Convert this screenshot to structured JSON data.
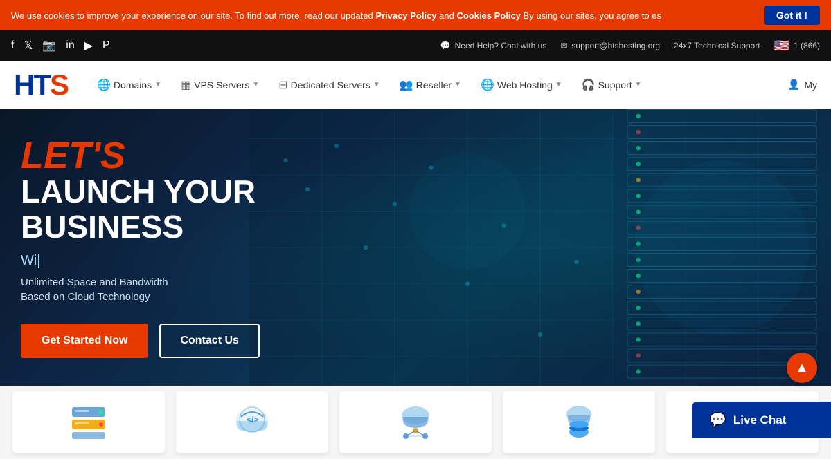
{
  "cookie": {
    "text": "We use cookies to improve your experience on our site. To find out more, read our updated ",
    "privacy_link": "Privacy Policy",
    "and": " and ",
    "cookies_link": "Cookies Policy",
    "suffix": " By using our sites, you agree to",
    "suffix2": "es",
    "btn_label": "Got it !"
  },
  "topbar": {
    "social_icons": [
      "facebook",
      "twitter",
      "instagram",
      "linkedin",
      "youtube",
      "pinterest"
    ],
    "chat_label": "Need Help? Chat with us",
    "email": "support@htshosting.org",
    "support_label": "24x7 Technical Support",
    "phone": "1 (866)"
  },
  "navbar": {
    "logo_text": "HTS",
    "menu_items": [
      {
        "icon": "🌐",
        "label": "Domains",
        "has_dropdown": true
      },
      {
        "icon": "🖥",
        "label": "VPS Servers",
        "has_dropdown": true
      },
      {
        "icon": "⬛",
        "label": "Dedicated Servers",
        "has_dropdown": true
      },
      {
        "icon": "👥",
        "label": "Reseller",
        "has_dropdown": true
      },
      {
        "icon": "🌐",
        "label": "Web Hosting",
        "has_dropdown": true
      },
      {
        "icon": "🎧",
        "label": "Support",
        "has_dropdown": true
      }
    ],
    "my_account_label": "My"
  },
  "hero": {
    "lets_text": "LET'S",
    "launch_text": "LAUNCH YOUR BUSINESS",
    "typing_text": "Wi",
    "sub1": "Unlimited Space and Bandwidth",
    "sub2": "Based on Cloud Technology",
    "btn_started": "Get Started Now",
    "btn_contact": "Contact Us"
  },
  "cards": [
    {
      "id": "card1",
      "color": "#e8f4f8"
    },
    {
      "id": "card2",
      "color": "#e8f8f0"
    },
    {
      "id": "card3",
      "color": "#e8f4f8"
    },
    {
      "id": "card4",
      "color": "#f0e8f8"
    },
    {
      "id": "card5",
      "color": "#f8f0e8"
    }
  ],
  "scroll_up": {
    "icon": "▲",
    "label": "scroll up"
  },
  "live_chat": {
    "icon": "💬",
    "label": "Live Chat"
  }
}
